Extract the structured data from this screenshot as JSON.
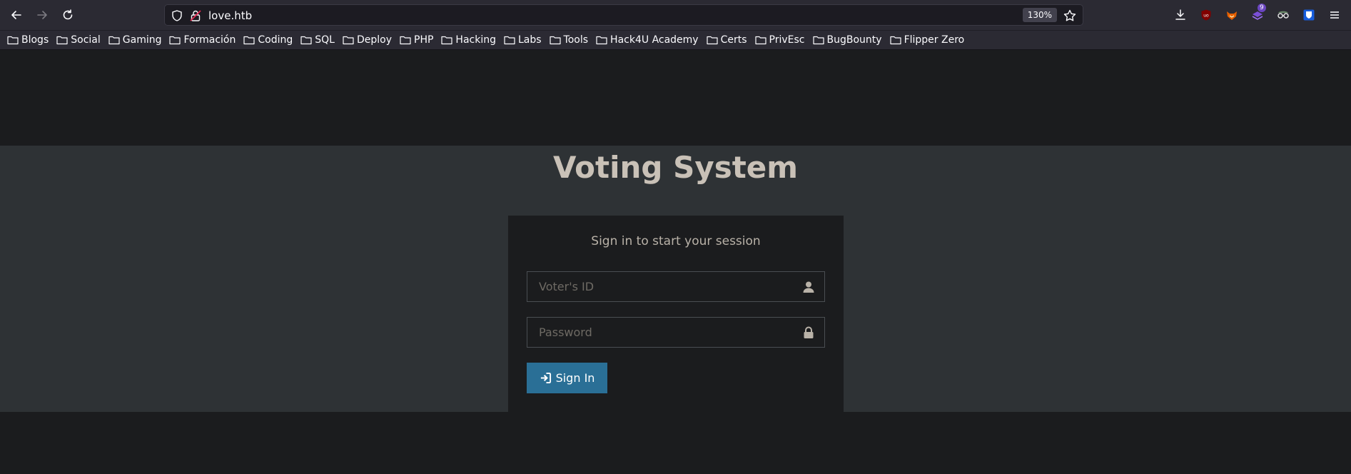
{
  "browser": {
    "url": "love.htb",
    "zoom": "130%",
    "extension_badge": "9",
    "bookmarks": [
      "Blogs",
      "Social",
      "Gaming",
      "Formación",
      "Coding",
      "SQL",
      "Deploy",
      "PHP",
      "Hacking",
      "Labs",
      "Tools",
      "Hack4U Academy",
      "Certs",
      "PrivEsc",
      "BugBounty",
      "Flipper Zero"
    ]
  },
  "page": {
    "title": "Voting System",
    "login_message": "Sign in to start your session",
    "voter_id_placeholder": "Voter's ID",
    "password_placeholder": "Password",
    "signin_label": "Sign In"
  },
  "colors": {
    "accent_button": "#2a6f96",
    "page_band": "#2e3235",
    "page_background": "#1b1c1e",
    "title_text": "#c9c1b7"
  }
}
